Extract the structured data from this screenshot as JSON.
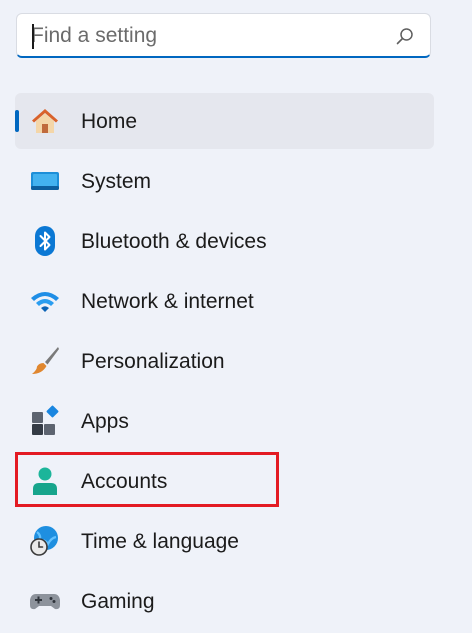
{
  "search": {
    "placeholder": "Find a setting",
    "value": ""
  },
  "nav": {
    "items": [
      {
        "label": "Home",
        "icon": "home-icon",
        "selected": true
      },
      {
        "label": "System",
        "icon": "system-icon",
        "selected": false
      },
      {
        "label": "Bluetooth & devices",
        "icon": "bluetooth-icon",
        "selected": false
      },
      {
        "label": "Network & internet",
        "icon": "wifi-icon",
        "selected": false
      },
      {
        "label": "Personalization",
        "icon": "paintbrush-icon",
        "selected": false
      },
      {
        "label": "Apps",
        "icon": "apps-icon",
        "selected": false
      },
      {
        "label": "Accounts",
        "icon": "account-icon",
        "selected": false
      },
      {
        "label": "Time & language",
        "icon": "globe-clock-icon",
        "selected": false
      },
      {
        "label": "Gaming",
        "icon": "gamepad-icon",
        "selected": false
      }
    ]
  },
  "colors": {
    "background": "#eff2f9",
    "accent": "#0067c0",
    "selected_bg": "#e5e7ee",
    "highlight": "#e31b23"
  }
}
